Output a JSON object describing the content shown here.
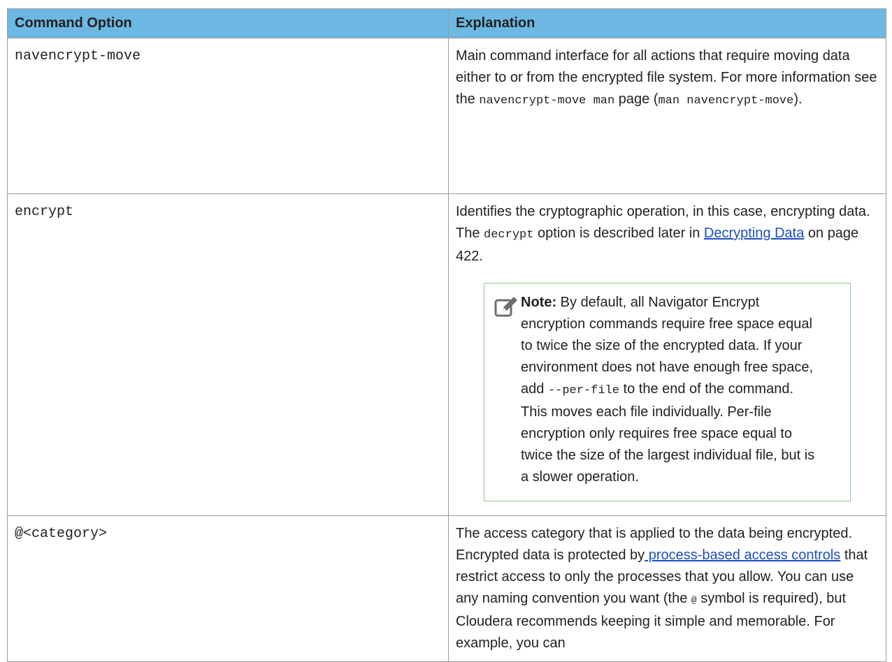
{
  "table": {
    "headers": [
      "Command Option",
      "Explanation"
    ],
    "row1": {
      "option": "navencrypt-move",
      "text1": "Main command interface for all actions that require moving data either to or from the encrypted file system. For more information see the ",
      "code1": "navencrypt-move man",
      "text2": " page (",
      "code2": "man navencrypt-move",
      "text3": ")."
    },
    "row2": {
      "option": "encrypt",
      "text1": "Identifies the cryptographic operation, in this case, encrypting data. The ",
      "code1": "decrypt",
      "text2": " option is described later in ",
      "link1": "Decrypting Data",
      "text3": " on page 422.",
      "note": {
        "label": "Note:",
        "text1": " By default, all Navigator Encrypt encryption commands require free space equal to twice the size of the encrypted data. If your environment does not have enough free space, add ",
        "code1": "--per-file",
        "text2": " to the end of the command. This moves each file individually. Per-file encryption only requires free space equal to twice the size of the largest individual file, but is a slower operation."
      }
    },
    "row3": {
      "option": "@<category>",
      "text1": "The access category that is applied to the data being encrypted. Encrypted data is protected by",
      "link1": " process-based access controls",
      "text2": " that restrict access to only the processes that you allow. You can use any naming convention you want (the ",
      "code1": "@",
      "text3": " symbol is required), but Cloudera recommends keeping it simple and memorable. For example, you can"
    }
  },
  "icons": {
    "note": "note-pencil-icon"
  },
  "colors": {
    "header_bg": "#6cb8e2",
    "note_border": "#8fc78f",
    "link": "#1d4fbf"
  }
}
